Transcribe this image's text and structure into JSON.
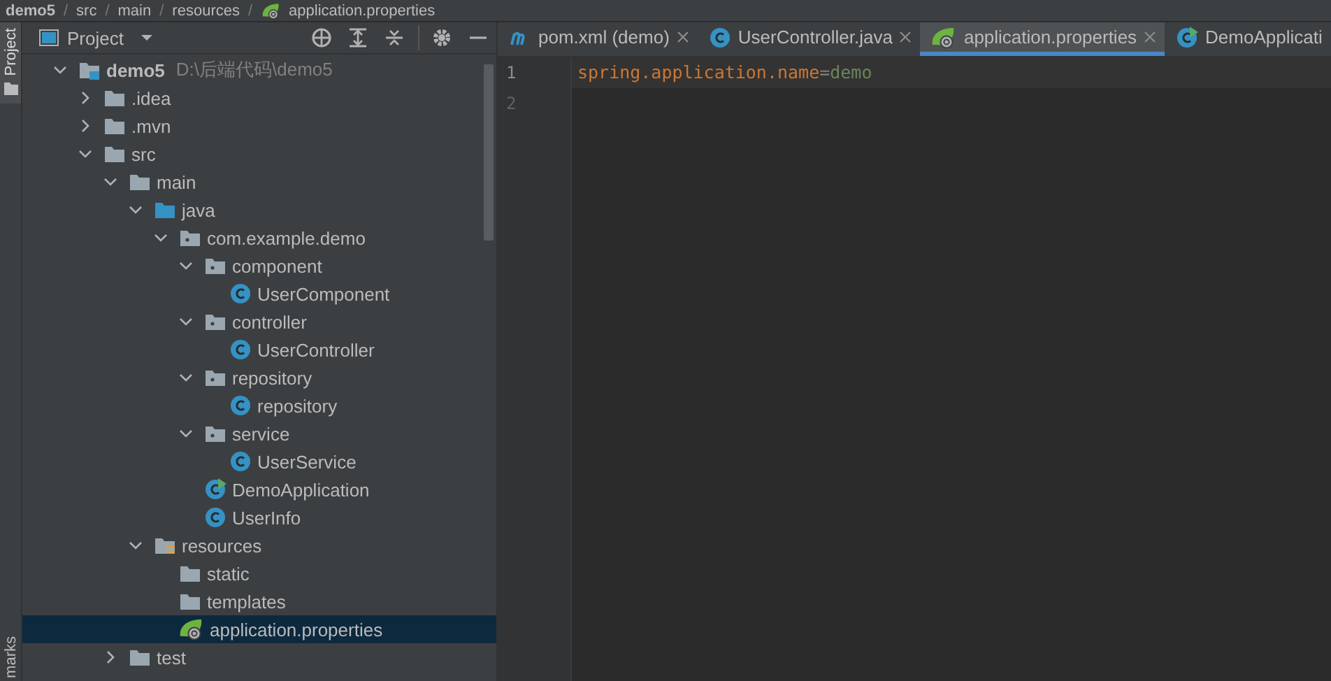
{
  "breadcrumb": {
    "separator": "/",
    "items": [
      "demo5",
      "src",
      "main",
      "resources",
      "application.properties"
    ]
  },
  "side_strip": {
    "top_tab": "Project",
    "bottom_tab": "marks"
  },
  "project_panel": {
    "title": "Project"
  },
  "tree": [
    {
      "label": "demo5",
      "note": "D:\\后端代码\\demo5",
      "kind": "module",
      "expanded": true,
      "selected": false,
      "children": [
        {
          "label": ".idea",
          "kind": "folder",
          "expanded": false,
          "selected": false
        },
        {
          "label": ".mvn",
          "kind": "folder",
          "expanded": false,
          "selected": false
        },
        {
          "label": "src",
          "kind": "folder",
          "expanded": true,
          "selected": false,
          "children": [
            {
              "label": "main",
              "kind": "folder",
              "expanded": true,
              "selected": false,
              "children": [
                {
                  "label": "java",
                  "kind": "source",
                  "expanded": true,
                  "selected": false,
                  "children": [
                    {
                      "label": "com.example.demo",
                      "kind": "package",
                      "expanded": true,
                      "selected": false,
                      "children": [
                        {
                          "label": "component",
                          "kind": "package",
                          "expanded": true,
                          "selected": false,
                          "children": [
                            {
                              "label": "UserComponent",
                              "kind": "class",
                              "selected": false
                            }
                          ]
                        },
                        {
                          "label": "controller",
                          "kind": "package",
                          "expanded": true,
                          "selected": false,
                          "children": [
                            {
                              "label": "UserController",
                              "kind": "class",
                              "selected": false
                            }
                          ]
                        },
                        {
                          "label": "repository",
                          "kind": "package",
                          "expanded": true,
                          "selected": false,
                          "children": [
                            {
                              "label": "repository",
                              "kind": "class",
                              "selected": false
                            }
                          ]
                        },
                        {
                          "label": "service",
                          "kind": "package",
                          "expanded": true,
                          "selected": false,
                          "children": [
                            {
                              "label": "UserService",
                              "kind": "class",
                              "selected": false
                            }
                          ]
                        },
                        {
                          "label": "DemoApplication",
                          "kind": "main",
                          "selected": false
                        },
                        {
                          "label": "UserInfo",
                          "kind": "class",
                          "selected": false
                        }
                      ]
                    }
                  ]
                },
                {
                  "label": "resources",
                  "kind": "resources",
                  "expanded": true,
                  "selected": false,
                  "children": [
                    {
                      "label": "static",
                      "kind": "folder",
                      "selected": false
                    },
                    {
                      "label": "templates",
                      "kind": "folder",
                      "selected": false
                    },
                    {
                      "label": "application.properties",
                      "kind": "spring",
                      "selected": true
                    }
                  ]
                }
              ]
            },
            {
              "label": "test",
              "kind": "folder",
              "expanded": false,
              "selected": false
            }
          ]
        }
      ]
    }
  ],
  "tabs": [
    {
      "label": "pom.xml (demo)",
      "kind": "maven",
      "selected": false,
      "closable": true
    },
    {
      "label": "UserController.java",
      "kind": "class",
      "selected": false,
      "closable": true
    },
    {
      "label": "application.properties",
      "kind": "spring",
      "selected": true,
      "closable": true
    },
    {
      "label": "DemoApplicati",
      "kind": "main",
      "selected": false,
      "closable": false
    }
  ],
  "editor": {
    "lines": [
      {
        "number": "1",
        "current": true,
        "tokens": [
          {
            "kind": "key",
            "text": "spring.application.name"
          },
          {
            "kind": "sep",
            "text": "="
          },
          {
            "kind": "value",
            "text": "demo"
          }
        ]
      },
      {
        "number": "2",
        "current": false
      }
    ]
  }
}
